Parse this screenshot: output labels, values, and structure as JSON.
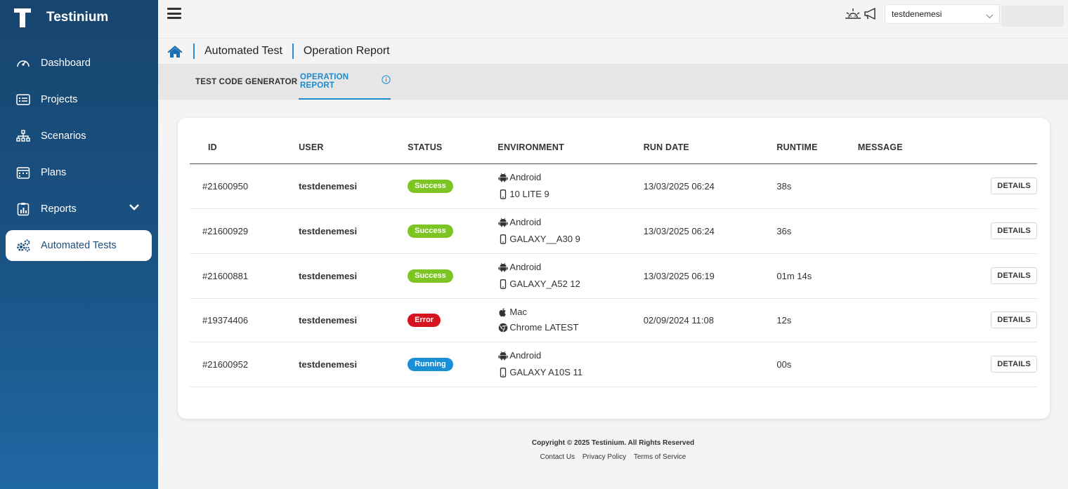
{
  "app": {
    "name": "Testinium"
  },
  "sidebar": {
    "items": [
      {
        "label": "Dashboard",
        "icon": "dashboard-gauge-icon"
      },
      {
        "label": "Projects",
        "icon": "projects-list-icon"
      },
      {
        "label": "Scenarios",
        "icon": "sitemap-icon"
      },
      {
        "label": "Plans",
        "icon": "calendar-icon"
      },
      {
        "label": "Reports",
        "icon": "report-chart-icon"
      },
      {
        "label": "Automated Tests",
        "icon": "gears-icon",
        "active": true
      }
    ]
  },
  "topbar": {
    "project_select": "testdenemesi"
  },
  "breadcrumb": {
    "items": [
      "Automated Test",
      "Operation Report"
    ]
  },
  "tabs": [
    {
      "label": "TEST CODE GENERATOR"
    },
    {
      "label": "OPERATION REPORT",
      "active": true
    }
  ],
  "table": {
    "headers": [
      "ID",
      "USER",
      "STATUS",
      "ENVIRONMENT",
      "RUN DATE",
      "RUNTIME",
      "MESSAGE"
    ],
    "details_label": "DETAILS",
    "rows": [
      {
        "id": "#21600950",
        "user": "testdenemesi",
        "status": "Success",
        "env_os": "Android",
        "env_device": "10 LITE 9",
        "run_date": "13/03/2025 06:24",
        "runtime": "38s",
        "message": ""
      },
      {
        "id": "#21600929",
        "user": "testdenemesi",
        "status": "Success",
        "env_os": "Android",
        "env_device": "GALAXY__A30 9",
        "run_date": "13/03/2025 06:24",
        "runtime": "36s",
        "message": ""
      },
      {
        "id": "#21600881",
        "user": "testdenemesi",
        "status": "Success",
        "env_os": "Android",
        "env_device": "GALAXY_A52 12",
        "run_date": "13/03/2025 06:19",
        "runtime": "01m 14s",
        "message": ""
      },
      {
        "id": "#19374406",
        "user": "testdenemesi",
        "status": "Error",
        "env_os": "Mac",
        "env_device": "Chrome LATEST",
        "run_date": "02/09/2024 11:08",
        "runtime": "12s",
        "message": ""
      },
      {
        "id": "#21600952",
        "user": "testdenemesi",
        "status": "Running",
        "env_os": "Android",
        "env_device": "GALAXY A10S 11",
        "run_date": "",
        "runtime": "00s",
        "message": ""
      }
    ]
  },
  "status_colors": {
    "Success": "#7cc524",
    "Error": "#d5141f",
    "Running": "#1a8fd6"
  },
  "footer": {
    "copyright": "Copyright © 2025 Testinium. All Rights Reserved",
    "links": [
      "Contact Us",
      "Privacy Policy",
      "Terms of Service"
    ]
  }
}
